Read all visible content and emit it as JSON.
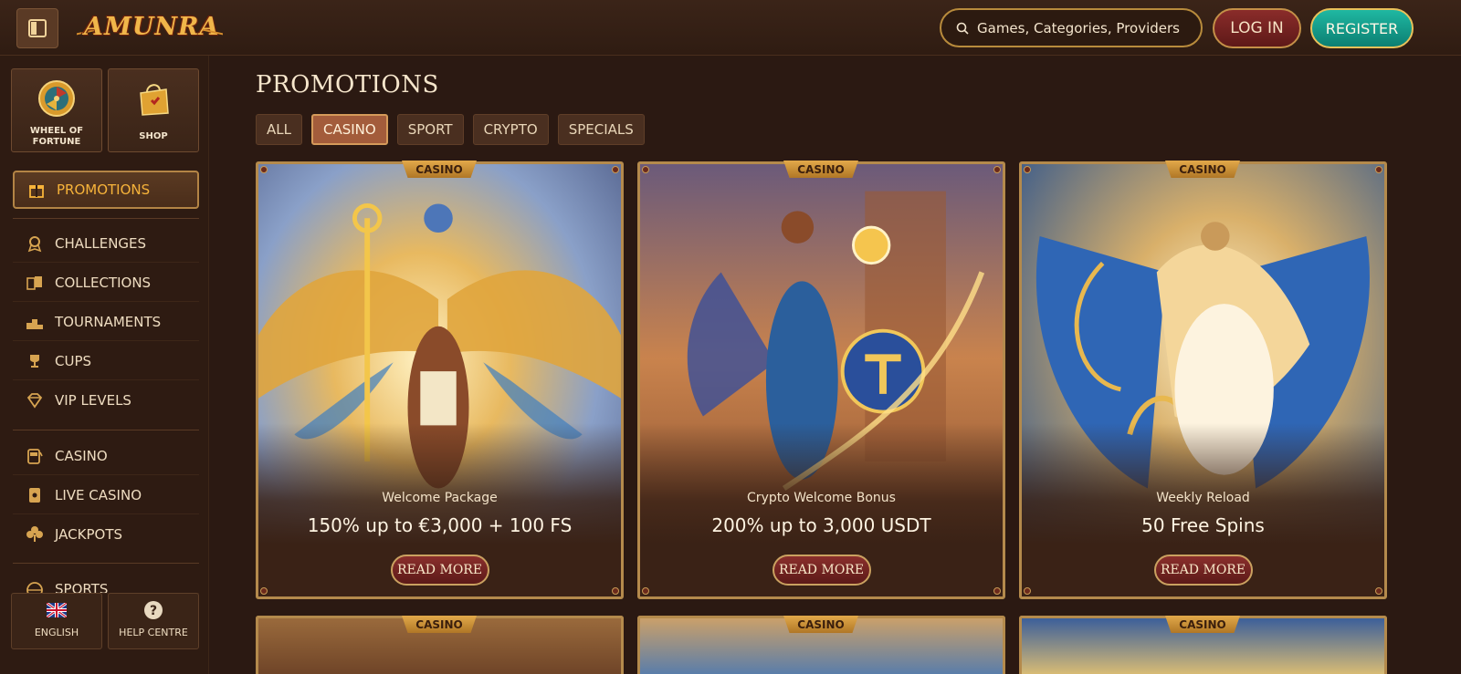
{
  "header": {
    "logo_text": "AMUNRA",
    "search_placeholder": "Games, Categories, Providers",
    "login_label": "LOG IN",
    "register_label": "REGISTER"
  },
  "sidebar": {
    "tiles": [
      {
        "label_line1": "WHEEL OF",
        "label_line2": "FORTUNE",
        "icon": "wheel-icon"
      },
      {
        "label": "SHOP",
        "icon": "shopping-bag-icon"
      }
    ],
    "active_item": {
      "label": "PROMOTIONS",
      "icon": "gift-icon"
    },
    "group1": [
      {
        "label": "CHALLENGES",
        "icon": "badge-icon"
      },
      {
        "label": "COLLECTIONS",
        "icon": "cards-icon"
      },
      {
        "label": "TOURNAMENTS",
        "icon": "podium-icon"
      },
      {
        "label": "CUPS",
        "icon": "trophy-icon"
      },
      {
        "label": "VIP LEVELS",
        "icon": "diamond-icon"
      }
    ],
    "group2": [
      {
        "label": "CASINO",
        "icon": "slot-machine-icon"
      },
      {
        "label": "LIVE CASINO",
        "icon": "playing-card-icon"
      },
      {
        "label": "JACKPOTS",
        "icon": "clover-icon"
      },
      {
        "label": "SPORTS",
        "icon": "ball-icon"
      }
    ],
    "bottom": [
      {
        "label": "ENGLISH",
        "icon": "uk-flag-icon"
      },
      {
        "label": "HELP CENTRE",
        "icon": "help-icon"
      }
    ]
  },
  "main": {
    "title": "PROMOTIONS",
    "tabs": [
      "ALL",
      "CASINO",
      "SPORT",
      "CRYPTO",
      "SPECIALS"
    ],
    "active_tab": "CASINO",
    "cards": [
      {
        "tag": "CASINO",
        "subtitle": "Welcome Package",
        "offer": "150% up to €3,000 + 100 FS",
        "button": "READ MORE"
      },
      {
        "tag": "CASINO",
        "subtitle": "Crypto Welcome Bonus",
        "offer": "200% up to 3,000 USDT",
        "button": "READ MORE"
      },
      {
        "tag": "CASINO",
        "subtitle": "Weekly Reload",
        "offer": "50 Free Spins",
        "button": "READ MORE"
      }
    ],
    "next_row_tags": [
      "CASINO",
      "CASINO",
      "CASINO"
    ]
  },
  "colors": {
    "background": "#2b1912",
    "gold": "#b48a4c",
    "active_accent": "#f7b33a",
    "register": "#1fb8a2",
    "login": "#8a2c2a"
  }
}
